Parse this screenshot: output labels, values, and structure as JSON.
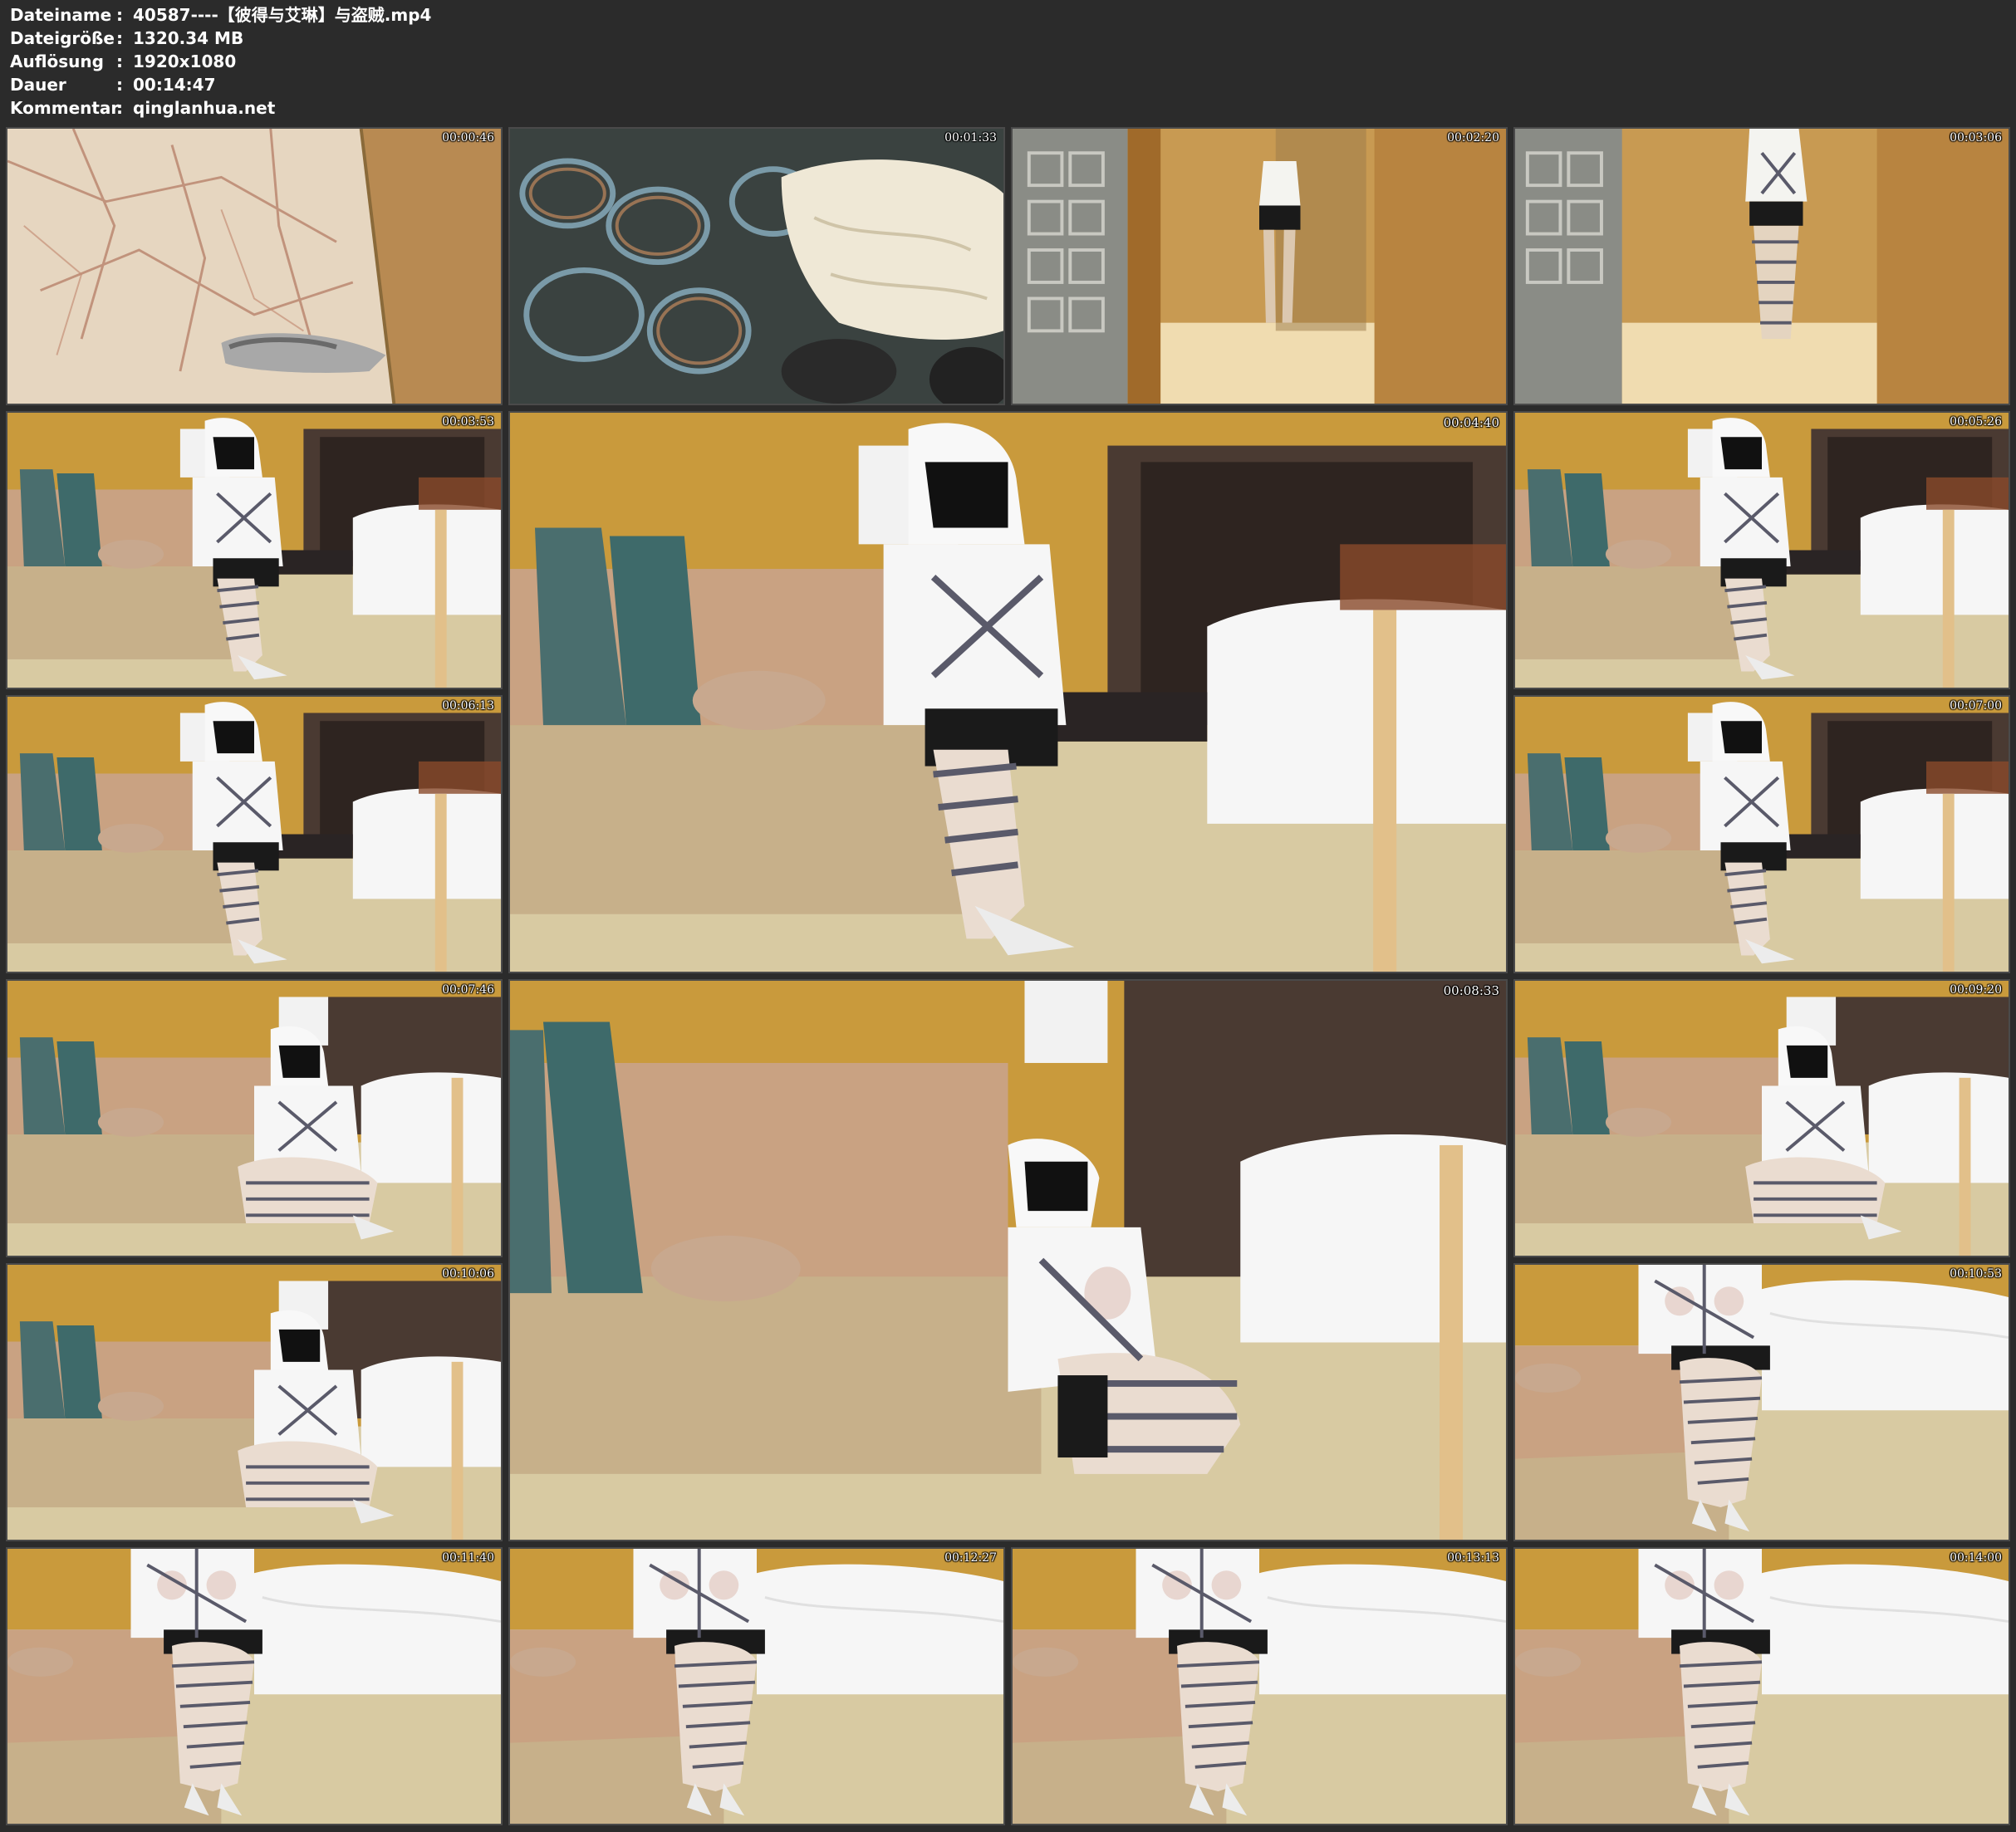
{
  "header": {
    "rows": [
      {
        "key": "Dateiname",
        "sep": ":",
        "value": "40587----【彼得与艾琳】与盗贼.mp4"
      },
      {
        "key": "Dateigröße",
        "sep": ":",
        "value": "1320.34 MB"
      },
      {
        "key": "Auflösung",
        "sep": ":",
        "value": "1920x1080"
      },
      {
        "key": "Dauer",
        "sep": ":",
        "value": "00:14:47"
      },
      {
        "key": "Kommentar",
        "sep": ":",
        "value": "qinglanhua.net"
      }
    ]
  },
  "thumbnails": [
    {
      "time": "00:00:46",
      "scene": "floor-heels"
    },
    {
      "time": "00:01:33",
      "scene": "ropes"
    },
    {
      "time": "00:02:20",
      "scene": "hallway-standing"
    },
    {
      "time": "00:03:06",
      "scene": "hallway-tied"
    },
    {
      "time": "00:03:53",
      "scene": "sofa-seated"
    },
    {
      "time": "00:04:40",
      "scene": "sofa-seated"
    },
    {
      "time": "00:05:26",
      "scene": "sofa-seated"
    },
    {
      "time": "00:06:13",
      "scene": "sofa-seated"
    },
    {
      "time": "00:07:00",
      "scene": "sofa-seated"
    },
    {
      "time": "00:07:46",
      "scene": "floor-kneeling"
    },
    {
      "time": "00:08:33",
      "scene": "floor-lying"
    },
    {
      "time": "00:09:20",
      "scene": "floor-kneeling"
    },
    {
      "time": "00:10:06",
      "scene": "floor-kneeling"
    },
    {
      "time": "00:10:53",
      "scene": "closeup-seated"
    },
    {
      "time": "00:11:40",
      "scene": "closeup-seated"
    },
    {
      "time": "00:12:27",
      "scene": "closeup-seated"
    },
    {
      "time": "00:13:13",
      "scene": "closeup-seated"
    },
    {
      "time": "00:14:00",
      "scene": "closeup-seated"
    }
  ]
}
